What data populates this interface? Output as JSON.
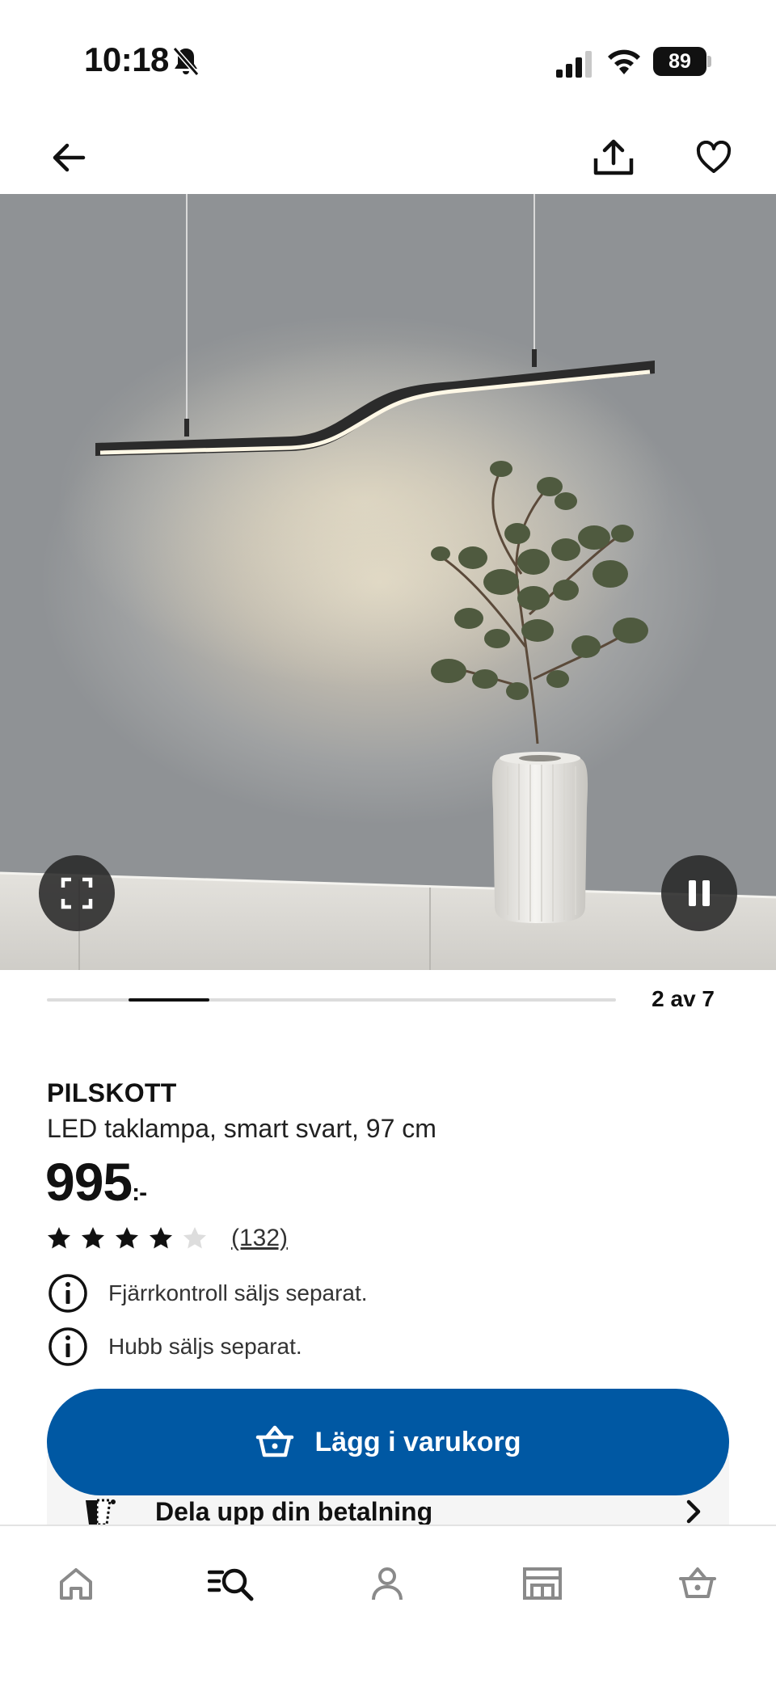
{
  "status_bar": {
    "time": "10:18",
    "battery": "89",
    "icons": [
      "bell-off-icon",
      "signal-icon",
      "wifi-icon",
      "battery-icon"
    ]
  },
  "top_nav": {
    "icons": [
      "arrow-left-icon",
      "share-icon",
      "heart-icon"
    ]
  },
  "gallery": {
    "counter": "2 av 7",
    "current_slide": 2,
    "total_slides": 7,
    "icons": [
      "fullscreen-icon",
      "pause-icon"
    ]
  },
  "product": {
    "brand": "PILSKOTT",
    "description": "LED taklampa, smart svart, 97 cm",
    "price": "995",
    "price_suffix": ":-",
    "rating_value": 4,
    "rating_max": 5,
    "review_count": "(132)",
    "notices": [
      {
        "text": "Fjärrkontroll säljs separat.",
        "icon": "info-icon"
      },
      {
        "text": "Hubb säljs separat.",
        "icon": "info-icon"
      }
    ]
  },
  "actions": {
    "add_to_cart_label": "Lägg i varukorg",
    "split_payment_label": "Dela upp din betalning"
  },
  "tab_bar": {
    "tabs": [
      {
        "name": "home",
        "icon": "home-icon"
      },
      {
        "name": "search",
        "icon": "search-list-icon"
      },
      {
        "name": "profile",
        "icon": "person-icon"
      },
      {
        "name": "store",
        "icon": "store-icon"
      },
      {
        "name": "cart",
        "icon": "basket-icon"
      }
    ]
  },
  "colors": {
    "primary": "#0058a3",
    "text": "#111111",
    "split_pay_bg": "#f5f5f5",
    "inactive_tab": "#8a8a8a"
  }
}
